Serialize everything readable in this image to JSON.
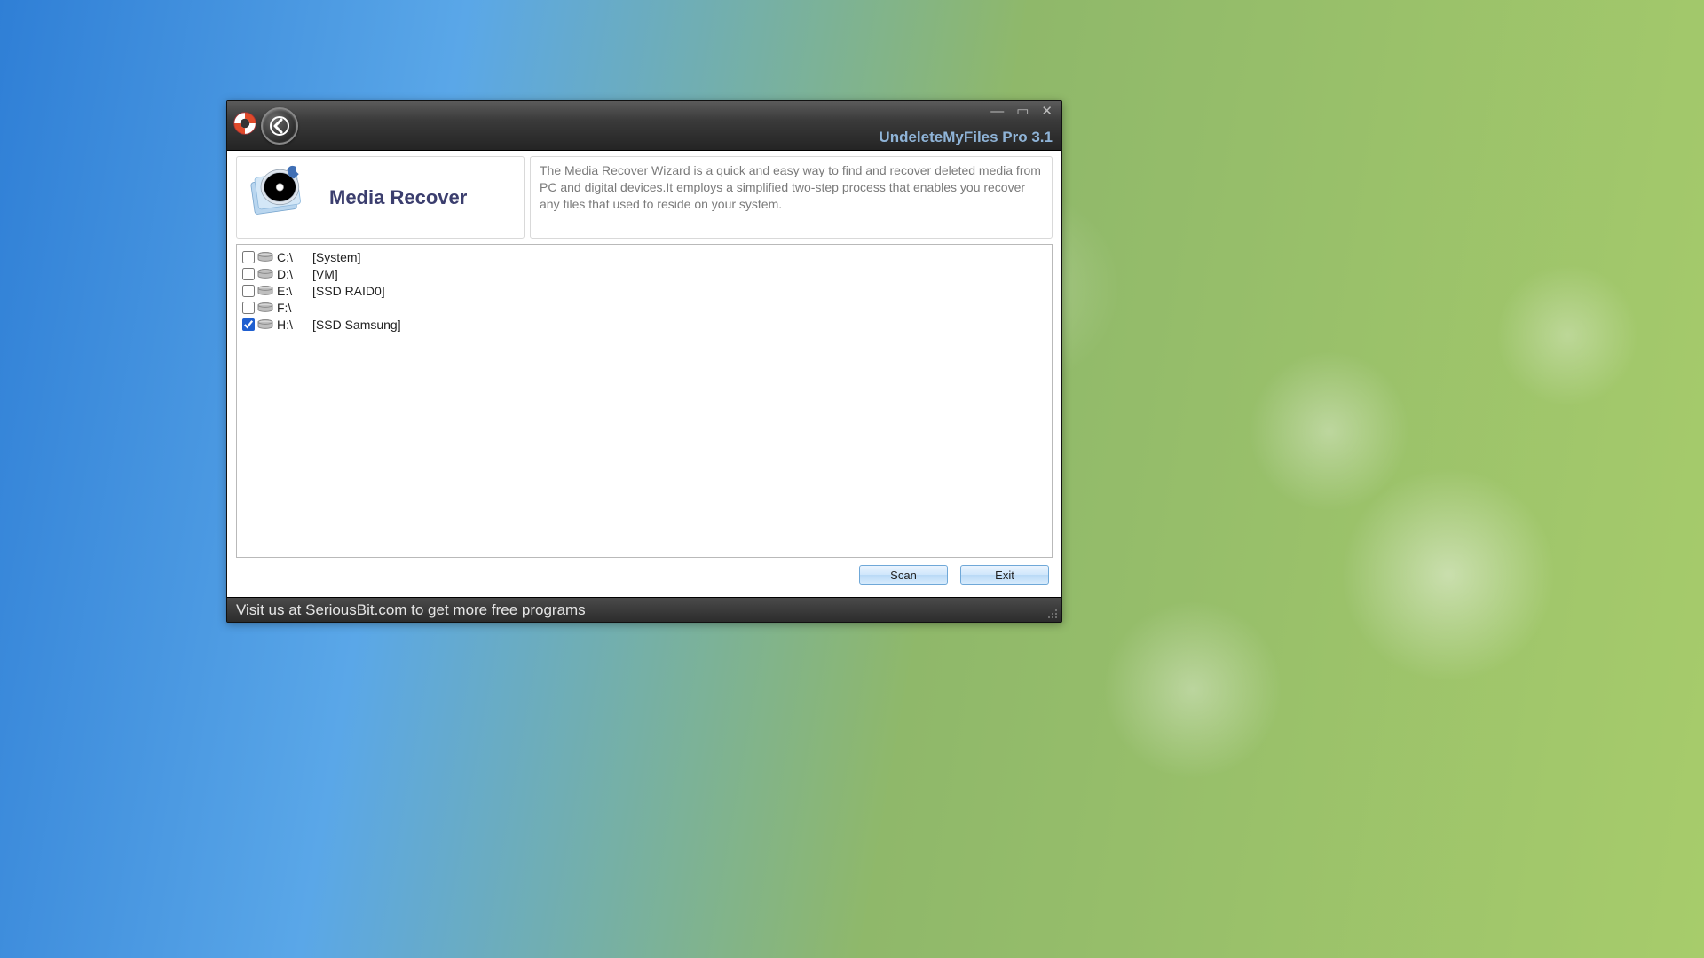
{
  "app_title": "UndeleteMyFiles Pro 3.1",
  "header": {
    "title": "Media Recover",
    "description": "The Media Recover Wizard is a quick and easy way to find and recover deleted media from PC and digital devices.It employs a simplified two-step process that enables you recover any files that used to reside on your system."
  },
  "drives": [
    {
      "letter": "C:\\",
      "label": "[System]",
      "checked": false
    },
    {
      "letter": "D:\\",
      "label": "[VM]",
      "checked": false
    },
    {
      "letter": "E:\\",
      "label": "[SSD RAID0]",
      "checked": false
    },
    {
      "letter": "F:\\",
      "label": "",
      "checked": false
    },
    {
      "letter": "H:\\",
      "label": "[SSD Samsung]",
      "checked": true
    }
  ],
  "buttons": {
    "scan": "Scan",
    "exit": "Exit"
  },
  "statusbar": "Visit us at SeriousBit.com to get more free programs"
}
